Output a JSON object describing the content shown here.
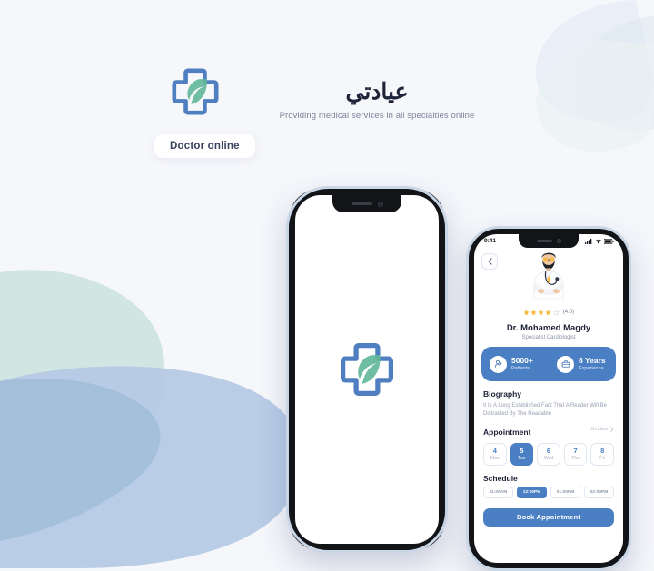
{
  "brand": {
    "logo_icon": "medical-cross-leaf-logo",
    "title_ar": "عيادتي",
    "tagline": "Providing medical services in all specialties online",
    "badge": "Doctor online"
  },
  "colors": {
    "page_bg": "#f6f7fb",
    "accent_blue": "#4a7fc4",
    "logo_blue": "#4f7fc0",
    "logo_green": "#63b79b",
    "blob_teal": "#cfe4e2",
    "blob_periwinkle": "#b4c8e4",
    "star_gold": "#f6b93b",
    "text_dark": "#1d2237",
    "text_muted": "#99a0b4"
  },
  "splash_screen": {
    "logo_icon": "medical-cross-leaf-logo",
    "background": "#ffffff"
  },
  "doctor_screen": {
    "statusbar": {
      "time": "9:41",
      "signal_icon": "cellular-signal-icon",
      "wifi_icon": "wifi-icon",
      "battery_icon": "battery-icon"
    },
    "back_icon": "chevron-left-icon",
    "avatar_icon": "doctor-illustration",
    "rating": {
      "filled_stars": 4,
      "total_stars": 5,
      "score_label": "(4.0)"
    },
    "name": "Dr. Mohamed Magdy",
    "specialty": "Specialist Cardiologist",
    "stats": [
      {
        "icon": "people-icon",
        "value": "5000+",
        "label": "Patients"
      },
      {
        "icon": "briefcase-icon",
        "value": "8 Years",
        "label": "Experience"
      }
    ],
    "biography": {
      "title": "Biography",
      "text": "It Is A Long Established Fact That A Reader Will Be Distracted By The Readable"
    },
    "appointment": {
      "title": "Appointment",
      "month": "October",
      "month_chevron_icon": "chevron-right-icon",
      "days": [
        {
          "num": "4",
          "name": "Mon",
          "selected": false
        },
        {
          "num": "5",
          "name": "Tue",
          "selected": true
        },
        {
          "num": "6",
          "name": "Wed",
          "selected": false
        },
        {
          "num": "7",
          "name": "Thu",
          "selected": false
        },
        {
          "num": "8",
          "name": "Fri",
          "selected": false
        }
      ]
    },
    "schedule": {
      "title": "Schedule",
      "slots": [
        {
          "time": "11:00AM",
          "selected": false
        },
        {
          "time": "12:00PM",
          "selected": true
        },
        {
          "time": "01:00PM",
          "selected": false
        },
        {
          "time": "02:00PM",
          "selected": false
        }
      ]
    },
    "book_button": "Book Appointment"
  }
}
